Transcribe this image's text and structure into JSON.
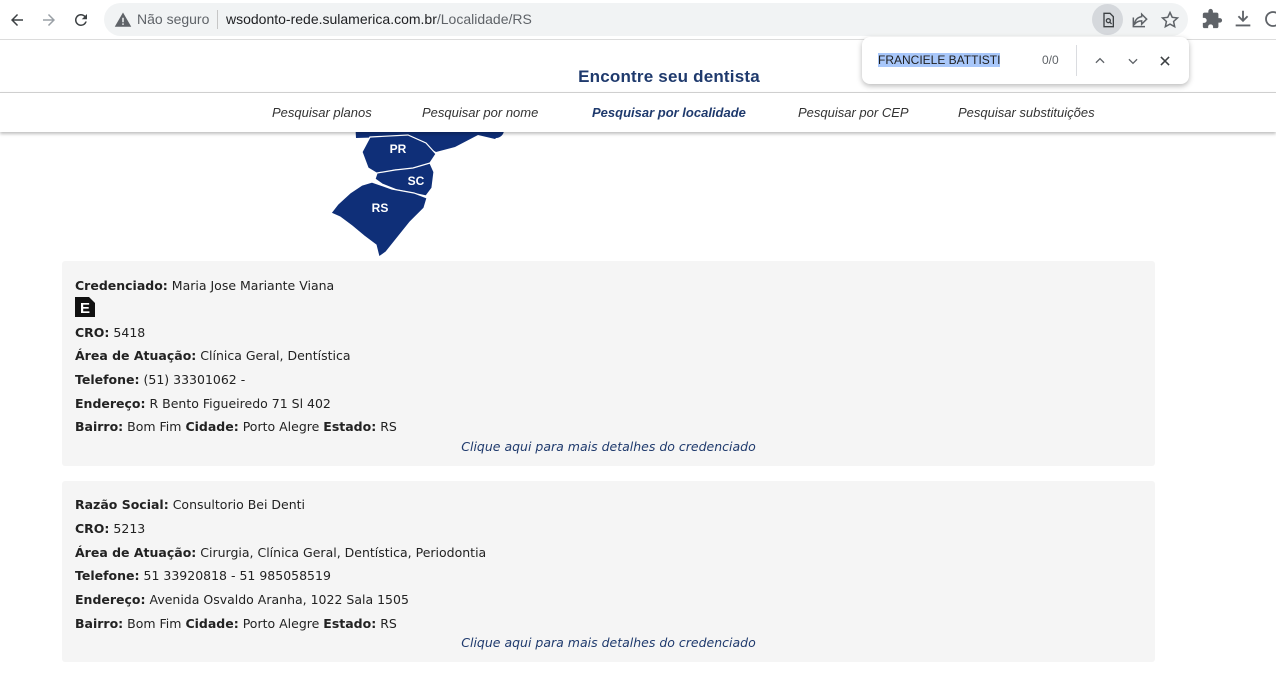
{
  "browser": {
    "security_label": "Não seguro",
    "url_host": "wsodonto-rede.sulamerica.com.br",
    "url_path": "/Localidade/RS"
  },
  "find_bar": {
    "query": "FRANCIELE BATTISTI",
    "count": "0/0"
  },
  "page": {
    "title": "Encontre seu dentista"
  },
  "nav": {
    "items": [
      {
        "label": "Pesquisar planos",
        "active": false
      },
      {
        "label": "Pesquisar por nome",
        "active": false
      },
      {
        "label": "Pesquisar por localidade",
        "active": true
      },
      {
        "label": "Pesquisar por CEP",
        "active": false
      },
      {
        "label": "Pesquisar substituições",
        "active": false
      }
    ]
  },
  "map": {
    "states": [
      "PR",
      "SC",
      "RS"
    ],
    "color": "#0f2f78"
  },
  "results": [
    {
      "name_label": "Credenciado:",
      "name": "Maria Jose Mariante Viana",
      "badge": "E",
      "cro_label": "CRO:",
      "cro": "5418",
      "area_label": "Área de Atuação:",
      "area": "Clínica Geral, Dentística",
      "phone_label": "Telefone:",
      "phone": "(51) 33301062 -",
      "address_label": "Endereço:",
      "address": "R Bento Figueiredo 71 Sl 402",
      "bairro_label": "Bairro:",
      "bairro": "Bom Fim",
      "cidade_label": "Cidade:",
      "cidade": "Porto Alegre",
      "estado_label": "Estado:",
      "estado": "RS",
      "details_link": "Clique aqui para mais detalhes do credenciado"
    },
    {
      "name_label": "Razão Social:",
      "name": "Consultorio Bei Denti",
      "cro_label": "CRO:",
      "cro": "5213",
      "area_label": "Área de Atuação:",
      "area": "Cirurgia, Clínica Geral, Dentística, Periodontia",
      "phone_label": "Telefone:",
      "phone": "51 33920818 - 51 985058519",
      "address_label": "Endereço:",
      "address": "Avenida Osvaldo Aranha, 1022 Sala 1505",
      "bairro_label": "Bairro:",
      "bairro": "Bom Fim",
      "cidade_label": "Cidade:",
      "cidade": "Porto Alegre",
      "estado_label": "Estado:",
      "estado": "RS",
      "details_link": "Clique aqui para mais detalhes do credenciado"
    }
  ]
}
